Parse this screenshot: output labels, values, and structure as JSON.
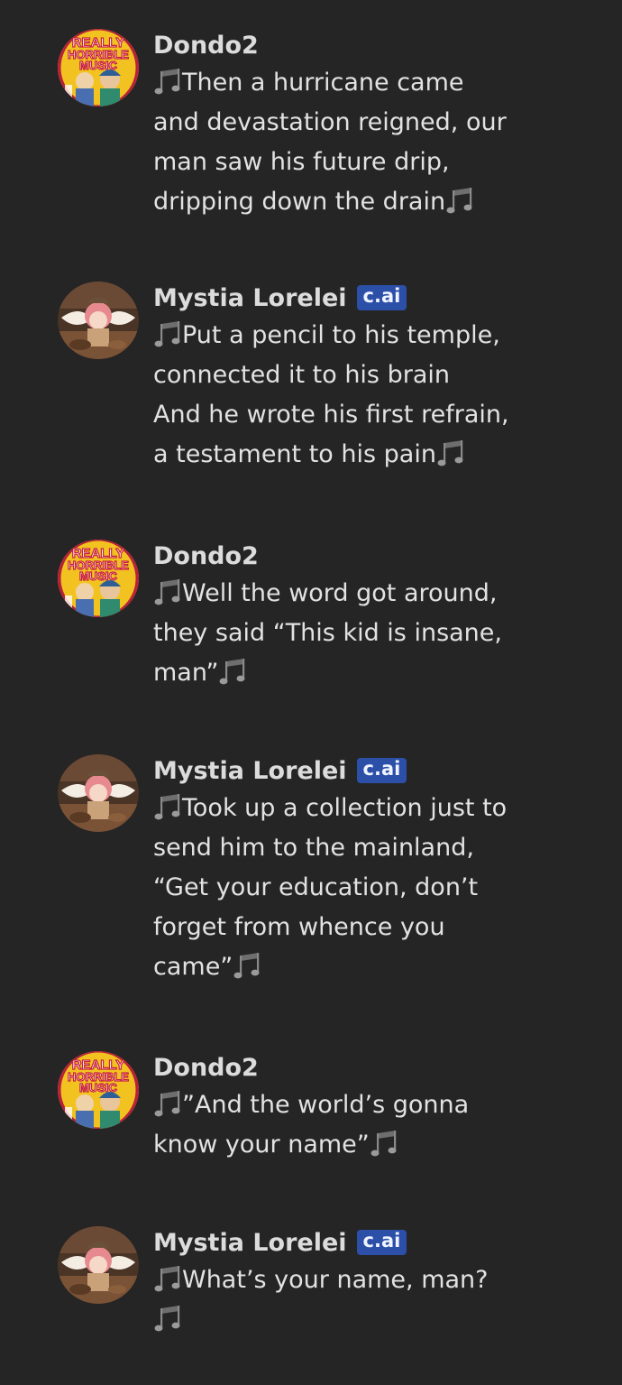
{
  "music_note_icon": "beamed-sixteenth-notes-icon",
  "colors": {
    "background": "#252525",
    "badge": "#2c4fa8",
    "text": "#e2e2e2"
  },
  "messages": [
    {
      "author": "Dondo2",
      "avatar": "really-horrible-music-avatar",
      "avatar_text": [
        "REALLY",
        "HORRIBLE",
        "MUSIC"
      ],
      "badge": "",
      "lines": [
        "Then a hurricane came",
        "and devastation reigned, our",
        "man saw his future drip,",
        "dripping down the drain"
      ]
    },
    {
      "author": "Mystia Lorelei",
      "avatar": "mystia-lorelei-avatar",
      "badge": "c.ai",
      "lines": [
        "Put a pencil to his temple,",
        "connected it to his brain",
        "And he wrote his first refrain,",
        "a testament to his pain"
      ]
    },
    {
      "author": "Dondo2",
      "avatar": "really-horrible-music-avatar",
      "avatar_text": [
        "REALLY",
        "HORRIBLE",
        "MUSIC"
      ],
      "badge": "",
      "lines": [
        "Well the word got around,",
        "they said “This kid is insane,",
        "man”"
      ]
    },
    {
      "author": "Mystia Lorelei",
      "avatar": "mystia-lorelei-avatar",
      "badge": "c.ai",
      "lines": [
        "Took up a collection just to",
        "send him to the mainland,",
        "“Get your education, don’t",
        "forget from whence you",
        "came”"
      ]
    },
    {
      "author": "Dondo2",
      "avatar": "really-horrible-music-avatar",
      "avatar_text": [
        "REALLY",
        "HORRIBLE",
        "MUSIC"
      ],
      "badge": "",
      "lines": [
        "”And the world’s gonna",
        "know your name”"
      ]
    },
    {
      "author": "Mystia Lorelei",
      "avatar": "mystia-lorelei-avatar",
      "badge": "c.ai",
      "lines": [
        "What’s your name, man?",
        ""
      ]
    }
  ]
}
